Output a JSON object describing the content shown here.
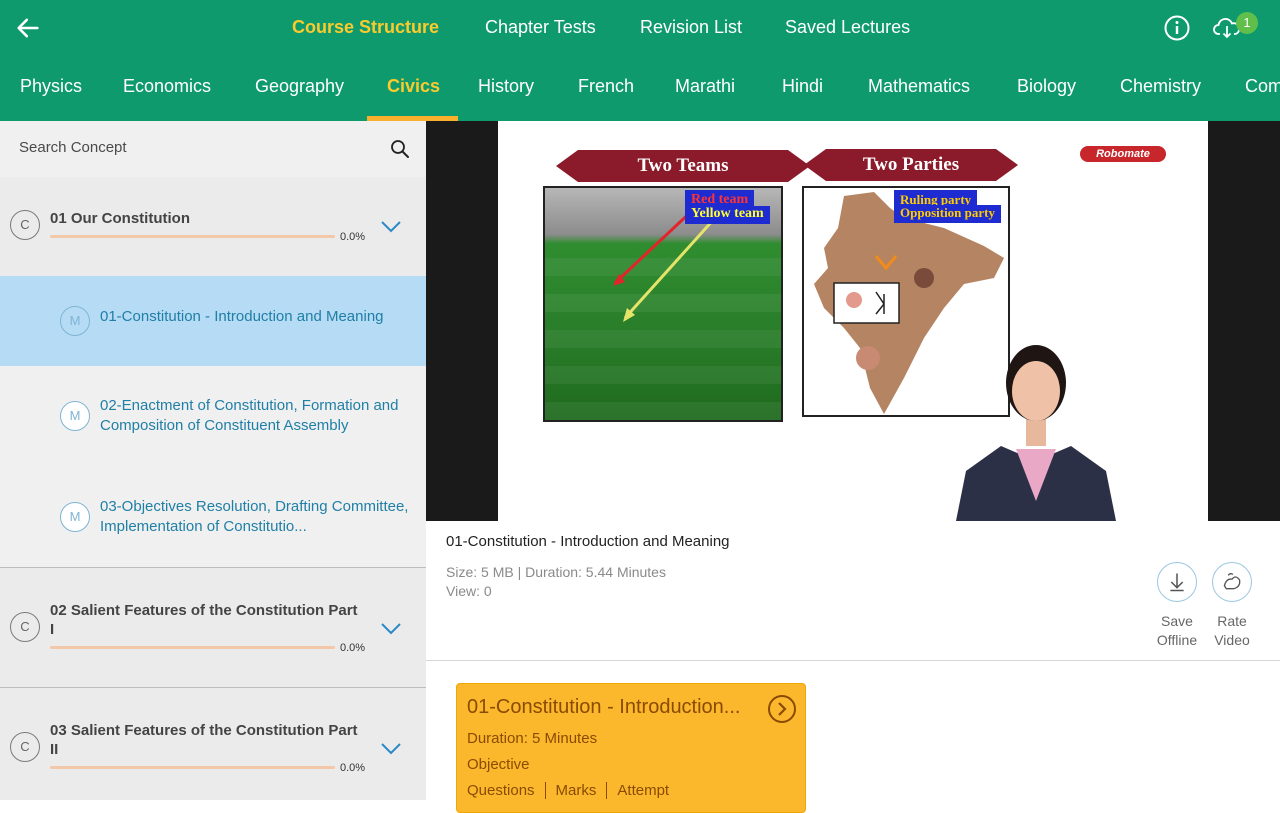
{
  "topnav": {
    "items": [
      "Course Structure",
      "Chapter Tests",
      "Revision List",
      "Saved Lectures"
    ],
    "active_index": 0,
    "badge": "1"
  },
  "subjects": {
    "items": [
      "Physics",
      "Economics",
      "Geography",
      "Civics",
      "History",
      "French",
      "Marathi",
      "Hindi",
      "Mathematics",
      "Biology",
      "Chemistry",
      "Com"
    ],
    "active": "Civics"
  },
  "search": {
    "placeholder": "Search Concept"
  },
  "chapters": [
    {
      "badge": "C",
      "title": "01 Our Constitution",
      "progress_text": "0.0%",
      "progress": 0.0
    },
    {
      "badge": "C",
      "title": "02 Salient Features of the Constitution Part I",
      "progress_text": "0.0%",
      "progress": 0.0
    },
    {
      "badge": "C",
      "title": "03 Salient Features of the Constitution Part II",
      "progress_text": "0.0%",
      "progress": 0.0
    }
  ],
  "modules": [
    {
      "badge": "M",
      "title": "01-Constitution - Introduction and Meaning",
      "active": true
    },
    {
      "badge": "M",
      "title": "02-Enactment of Constitution, Formation and Composition of Constituent Assembly",
      "active": false
    },
    {
      "badge": "M",
      "title": "03-Objectives Resolution, Drafting Committee, Implementation of Constitutio...",
      "active": false
    }
  ],
  "slide": {
    "banner_left": "Two Teams",
    "banner_right": "Two Parties",
    "tag_red_team": "Red team",
    "tag_yellow_team": "Yellow team",
    "tag_ruling": "Ruling party",
    "tag_opposition": "Opposition party",
    "logo": "Robomate"
  },
  "video_info": {
    "title": "01-Constitution - Introduction and Meaning",
    "meta_line1": "Size: 5 MB | Duration: 5.44 Minutes",
    "meta_line2": "View: 0",
    "save_line1": "Save",
    "save_line2": "Offline",
    "rate_line1": "Rate",
    "rate_line2": "Video"
  },
  "test_card": {
    "title": "01-Constitution - Introduction...",
    "duration": "Duration: 5 Minutes",
    "type": "Objective",
    "col1": "Questions",
    "col2": "Marks",
    "col3": "Attempt"
  },
  "colors": {
    "appbar": "#0f9a6e",
    "active_tab": "#fbcb2d",
    "module_active_bg": "#b6dbf5",
    "card_bg": "#fbb82d"
  }
}
